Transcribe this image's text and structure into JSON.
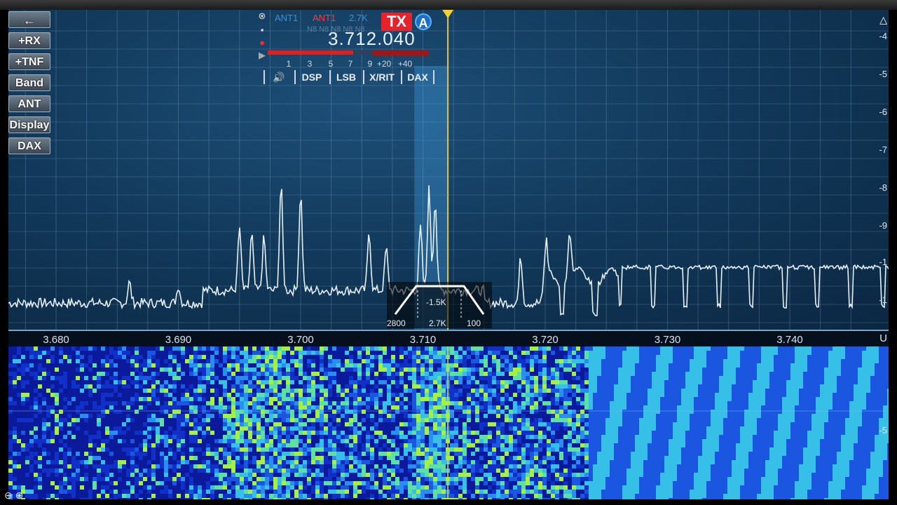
{
  "left_menu": [
    {
      "id": "back",
      "label": "←"
    },
    {
      "id": "rx",
      "label": "+RX"
    },
    {
      "id": "tnf",
      "label": "+TNF"
    },
    {
      "id": "band",
      "label": "Band"
    },
    {
      "id": "ant",
      "label": "ANT"
    },
    {
      "id": "display",
      "label": "Display"
    },
    {
      "id": "dax",
      "label": "DAX"
    }
  ],
  "slice": {
    "rx_antenna": "ANT1",
    "tx_antenna": "ANT1",
    "filter_width": "2.7K",
    "tx_label": "TX",
    "slice_letter": "A",
    "callsign": "N8 N8 N8 N8 N8",
    "frequency": "3.712.040",
    "smeter_fill": 0.53,
    "smeter_scale": [
      "1",
      "3",
      "5",
      "7",
      "9",
      "+20",
      "+40"
    ],
    "buttons": [
      "🔊",
      "DSP",
      "LSB",
      "X/RIT",
      "DAX"
    ]
  },
  "freq_axis": {
    "labels": [
      "3.680",
      "3.690",
      "3.700",
      "3.710",
      "3.720",
      "3.730",
      "3.740"
    ],
    "values": [
      3.68,
      3.69,
      3.7,
      3.71,
      3.72,
      3.73,
      3.74
    ],
    "unit": "U"
  },
  "db_scale": [
    "-4",
    "-5",
    "-6",
    "-7",
    "-8",
    "-9",
    "-1",
    "-1"
  ],
  "filter": {
    "center": "-1.5K",
    "low": "2800",
    "mid": "2.7K",
    "high": "100"
  },
  "waterfall_scale": "-5",
  "colors": {
    "tx_red": "#e8222a",
    "slice_blue": "#1e6fc0",
    "tuning_line": "#e5c54a",
    "trace": "#e8f2fb"
  }
}
